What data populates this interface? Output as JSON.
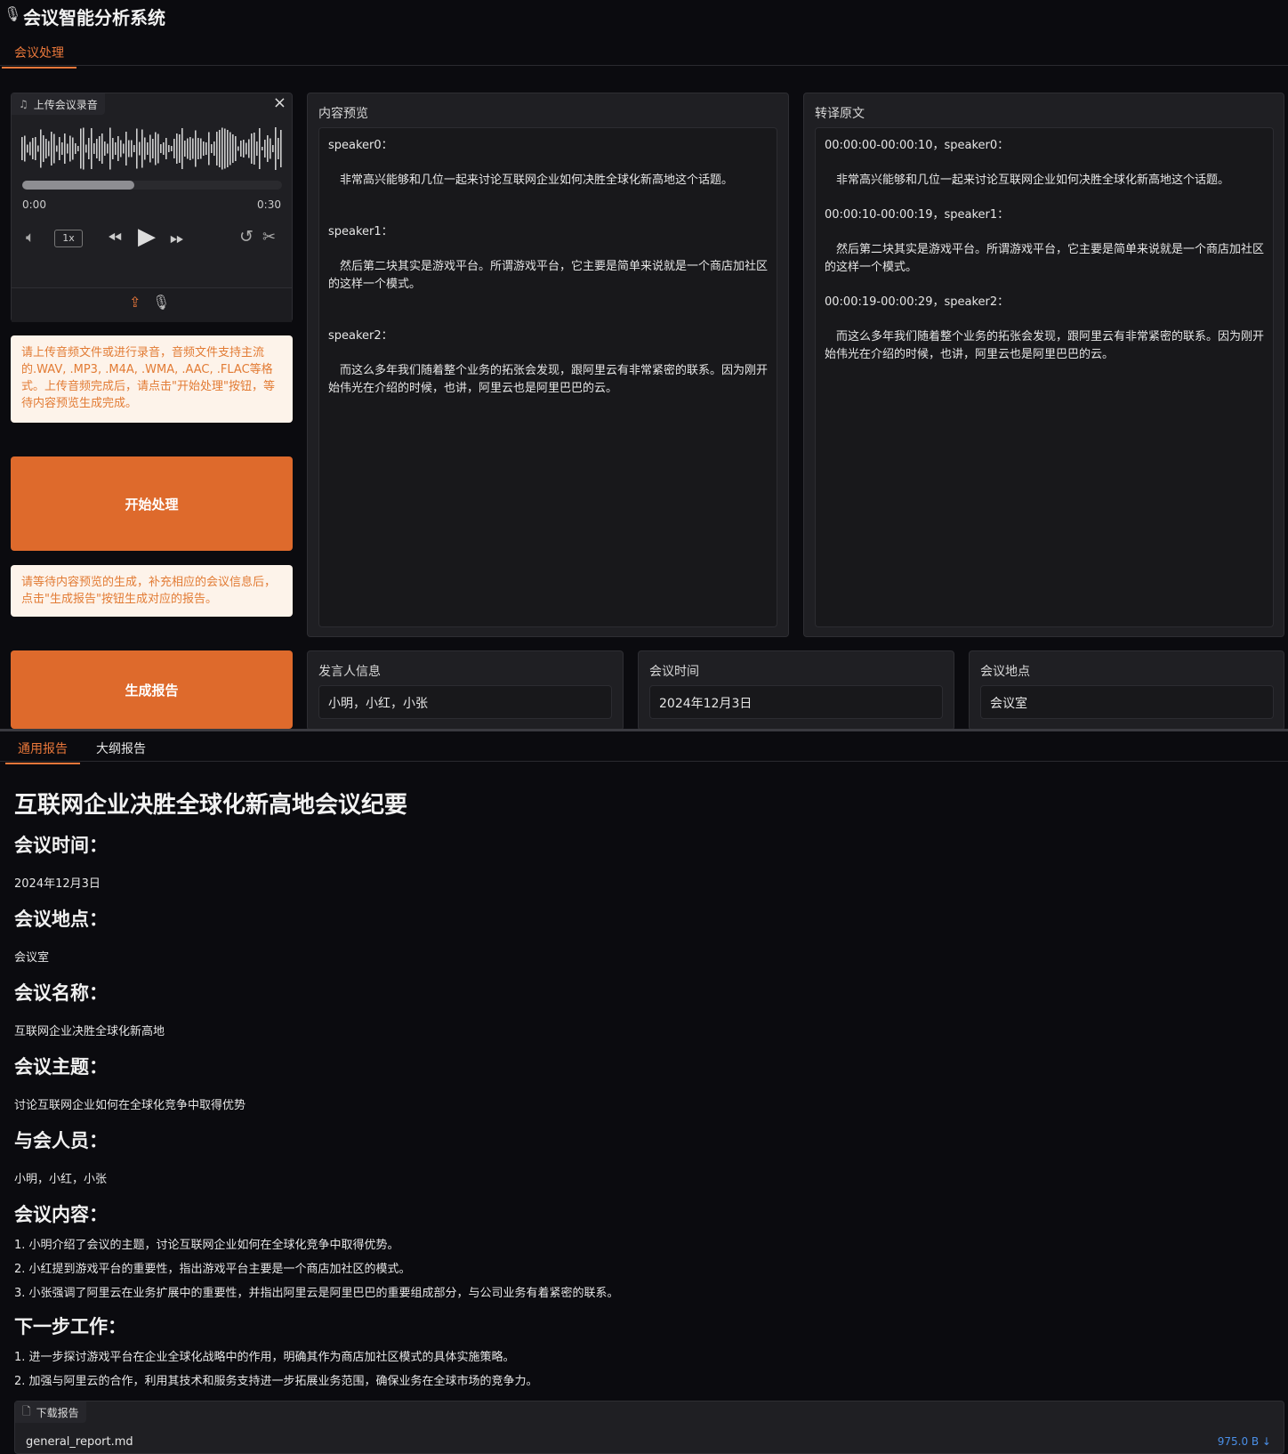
{
  "app": {
    "title": "会议智能分析系统",
    "title_icon": "microphone-icon"
  },
  "top_tabs": [
    {
      "label": "会议处理",
      "active": true
    }
  ],
  "audio": {
    "label": "上传会议录音",
    "time_start": "0:00",
    "time_end": "0:30",
    "speed": "1x",
    "progress": 0.43
  },
  "notice1": "请上传音频文件或进行录音，音频文件支持主流的.WAV, .MP3, .M4A, .WMA, .AAC, .FLAC等格式。上传音频完成后，请点击\"开始处理\"按钮，等待内容预览生成完成。",
  "start_button": "开始处理",
  "notice2": "请等待内容预览的生成，补充相应的会议信息后，点击\"生成报告\"按钮生成对应的报告。",
  "report_button": "生成报告",
  "preview": {
    "label": "内容预览",
    "entries": [
      {
        "speaker": "speaker0：",
        "text": "　非常高兴能够和几位一起来讨论互联网企业如何决胜全球化新高地这个话题。"
      },
      {
        "speaker": "speaker1：",
        "text": "　然后第二块其实是游戏平台。所谓游戏平台，它主要是简单来说就是一个商店加社区的这样一个模式。"
      },
      {
        "speaker": "speaker2：",
        "text": "　而这么多年我们随着整个业务的拓张会发现，跟阿里云有非常紧密的联系。因为刚开始伟光在介绍的时候，也讲，阿里云也是阿里巴巴的云。"
      }
    ]
  },
  "transcript": {
    "label": "转译原文",
    "entries": [
      {
        "header": "00:00:00-00:00:10，speaker0：",
        "text": "　非常高兴能够和几位一起来讨论互联网企业如何决胜全球化新高地这个话题。"
      },
      {
        "header": "00:00:10-00:00:19，speaker1：",
        "text": "　然后第二块其实是游戏平台。所谓游戏平台，它主要是简单来说就是一个商店加社区的这样一个模式。"
      },
      {
        "header": "00:00:19-00:00:29，speaker2：",
        "text": "　而这么多年我们随着整个业务的拓张会发现，跟阿里云有非常紧密的联系。因为刚开始伟光在介绍的时候，也讲，阿里云也是阿里巴巴的云。"
      }
    ]
  },
  "fields": {
    "speakers": {
      "label": "发言人信息",
      "value": "小明，小红，小张"
    },
    "time": {
      "label": "会议时间",
      "value": "2024年12月3日"
    },
    "location": {
      "label": "会议地点",
      "value": "会议室"
    }
  },
  "report_tabs": [
    {
      "label": "通用报告",
      "active": true
    },
    {
      "label": "大纲报告",
      "active": false
    }
  ],
  "report": {
    "title": "互联网企业决胜全球化新高地会议纪要",
    "time_heading": "会议时间：",
    "time_value": "2024年12月3日",
    "location_heading": "会议地点：",
    "location_value": "会议室",
    "name_heading": "会议名称：",
    "name_value": "互联网企业决胜全球化新高地",
    "topic_heading": "会议主题：",
    "topic_value": "讨论互联网企业如何在全球化竞争中取得优势",
    "attendees_heading": "与会人员：",
    "attendees_value": "小明，小红，小张",
    "content_heading": "会议内容：",
    "content_items": [
      "1. 小明介绍了会议的主题，讨论互联网企业如何在全球化竞争中取得优势。",
      "2. 小红提到游戏平台的重要性，指出游戏平台主要是一个商店加社区的模式。",
      "3. 小张强调了阿里云在业务扩展中的重要性，并指出阿里云是阿里巴巴的重要组成部分，与公司业务有着紧密的联系。"
    ],
    "next_heading": "下一步工作：",
    "next_items": [
      "1. 进一步探讨游戏平台在企业全球化战略中的作用，明确其作为商店加社区模式的具体实施策略。",
      "2. 加强与阿里云的合作，利用其技术和服务支持进一步拓展业务范围，确保业务在全球市场的竞争力。"
    ]
  },
  "download": {
    "label": "下载报告",
    "filename": "general_report.md",
    "size": "975.0 B ↓"
  },
  "colors": {
    "accent": "#de6a2c",
    "tab_active": "#e9773a",
    "notice_bg": "#fdf3ea",
    "notice_text": "#e27b34"
  }
}
